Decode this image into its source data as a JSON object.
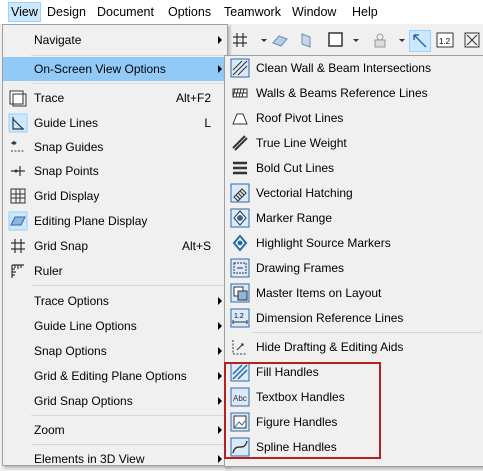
{
  "menubar": {
    "items": [
      "View",
      "Design",
      "Document",
      "Options",
      "Teamwork",
      "Window",
      "Help"
    ]
  },
  "main_menu": {
    "items": [
      {
        "label": "Navigate",
        "submenu": true
      },
      {
        "label": "On-Screen View Options",
        "submenu": true,
        "highlighted": true
      },
      {
        "label": "Trace",
        "shortcut": "Alt+F2",
        "icon": "trace-icon"
      },
      {
        "label": "Guide Lines",
        "shortcut": "L",
        "icon": "guide-lines-icon"
      },
      {
        "label": "Snap Guides",
        "icon": "snap-guides-icon"
      },
      {
        "label": "Snap Points",
        "icon": "snap-points-icon"
      },
      {
        "label": "Grid Display",
        "icon": "grid-display-icon"
      },
      {
        "label": "Editing Plane Display",
        "icon": "editing-plane-icon"
      },
      {
        "label": "Grid Snap",
        "shortcut": "Alt+S",
        "icon": "grid-snap-icon"
      },
      {
        "label": "Ruler",
        "icon": "ruler-icon"
      },
      {
        "label": "Trace Options",
        "submenu": true
      },
      {
        "label": "Guide Line Options",
        "submenu": true
      },
      {
        "label": "Snap Options",
        "submenu": true
      },
      {
        "label": "Grid & Editing Plane Options",
        "submenu": true
      },
      {
        "label": "Grid Snap Options",
        "submenu": true
      },
      {
        "label": "Zoom",
        "submenu": true
      },
      {
        "label": "Elements in 3D View",
        "submenu": true
      }
    ]
  },
  "sub_menu": {
    "items": [
      {
        "label": "Clean Wall & Beam Intersections",
        "icon": "clean-intersections-icon"
      },
      {
        "label": "Walls & Beams Reference Lines",
        "icon": "reference-lines-icon"
      },
      {
        "label": "Roof Pivot Lines",
        "icon": "roof-pivot-icon"
      },
      {
        "label": "True Line Weight",
        "icon": "line-weight-icon"
      },
      {
        "label": "Bold Cut Lines",
        "icon": "bold-cut-icon"
      },
      {
        "label": "Vectorial Hatching",
        "icon": "hatching-icon"
      },
      {
        "label": "Marker Range",
        "icon": "marker-range-icon"
      },
      {
        "label": "Highlight Source Markers",
        "icon": "source-markers-icon"
      },
      {
        "label": "Drawing Frames",
        "icon": "drawing-frames-icon"
      },
      {
        "label": "Master Items on Layout",
        "icon": "master-items-icon"
      },
      {
        "label": "Dimension Reference Lines",
        "icon": "dimension-icon"
      },
      {
        "label": "Hide Drafting & Editing Aids",
        "icon": "hide-aids-icon"
      },
      {
        "label": "Fill Handles",
        "icon": "fill-handles-icon"
      },
      {
        "label": "Textbox Handles",
        "icon": "textbox-handles-icon"
      },
      {
        "label": "Figure Handles",
        "icon": "figure-handles-icon"
      },
      {
        "label": "Spline Handles",
        "icon": "spline-handles-icon"
      }
    ]
  },
  "colors": {
    "highlight": "#91c9f7",
    "accent": "#2b6aa9",
    "annotation": "#b22222"
  }
}
